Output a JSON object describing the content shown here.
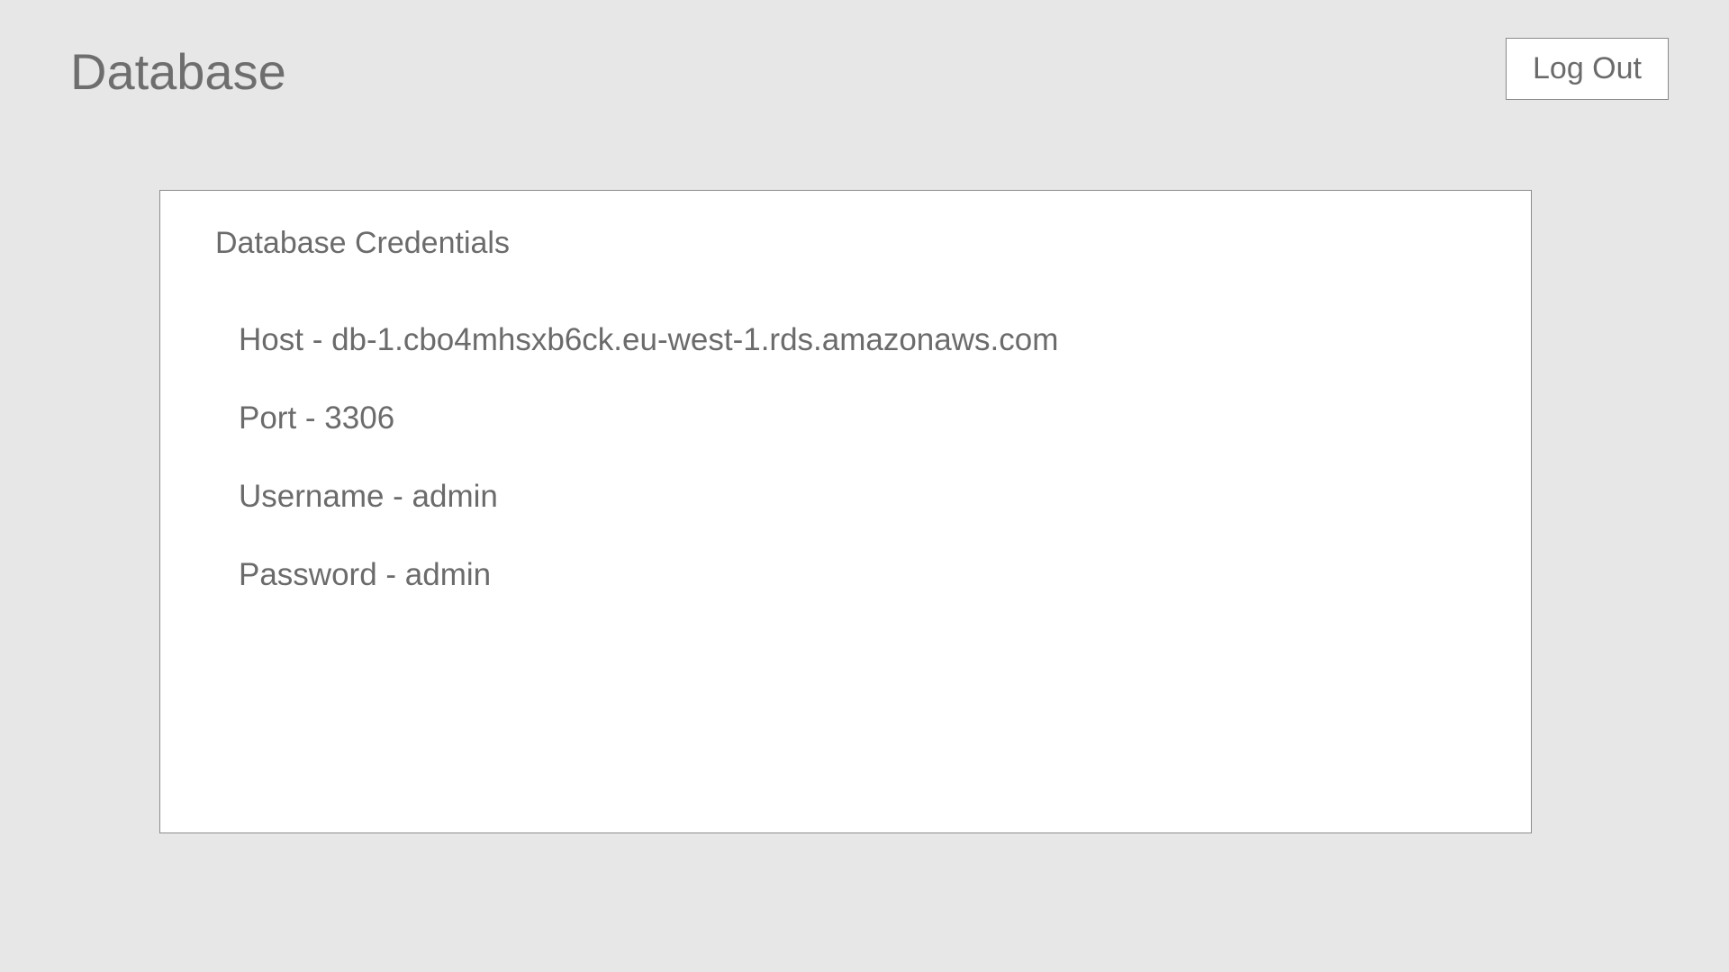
{
  "header": {
    "title": "Database",
    "logout_label": "Log Out"
  },
  "card": {
    "title": "Database Credentials",
    "rows": [
      {
        "label": "Host",
        "value": "db-1.cbo4mhsxb6ck.eu-west-1.rds.amazonaws.com",
        "text": "Host - db-1.cbo4mhsxb6ck.eu-west-1.rds.amazonaws.com"
      },
      {
        "label": "Port",
        "value": "3306",
        "text": "Port - 3306"
      },
      {
        "label": "Username",
        "value": "admin",
        "text": "Username - admin"
      },
      {
        "label": "Password",
        "value": "admin",
        "text": "Password - admin"
      }
    ]
  },
  "colors": {
    "background": "#e7e7e7",
    "card": "#ffffff",
    "text": "#6b6b6b",
    "border": "#8c8c8c"
  }
}
